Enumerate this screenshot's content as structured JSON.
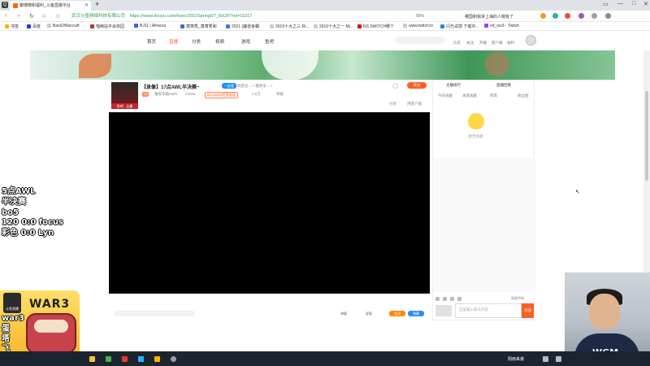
{
  "browser": {
    "tab_title": "秦珊珊和福利_斗鱼直播平台",
    "new_tab_symbol": "+",
    "url_site": "武汉斗鱼网络科技有限公司",
    "url": "https://www.douyu.com/topic/2022SpringST_BXZF?rid=11017",
    "zoom": "90%",
    "hot_news": "哪国和我讲上海的人嗯有了",
    "bookmarks": [
      "书签",
      "百度",
      "Back2Warcraft",
      "喵两站平会依园",
      "BJ11 | Afreeca",
      "萧萧秀_萧萧秀和",
      "2021 (魔兽争霸",
      "2010十大之三 Ri...",
      "2010十大之一 Mi...",
      "NS SWITCH哪个",
      "www.twitch.tv",
      "闪光试感 下载中...",
      "ed_wo3 - Twitch"
    ]
  },
  "douyu_nav": {
    "items": [
      "首页",
      "直播",
      "分类",
      "视频",
      "游戏",
      "鱼吧"
    ],
    "active_index": 1,
    "links": [
      "历史",
      "关注",
      "开播",
      "客户端",
      "福利"
    ]
  },
  "room": {
    "title": "【录像】17点AWL半决赛~",
    "category_tag": "一起看",
    "category_link": "网游竞... > 魔兽争... >",
    "meta_level": "13",
    "meta_name": "魔兽争霸e800",
    "meta_heat": "24008",
    "meta_event": "WCG2019世界总冠",
    "meta_report": "举报",
    "meta_share": "分享",
    "meta_client": "用客户端",
    "meta_follow_count": "1.5万",
    "streamer_badge": "鱼吧 · 云霸",
    "follow_label": "关注"
  },
  "player_bar": {
    "option_1": "弹幕",
    "option_2": "屏蔽",
    "send_1": "发送",
    "send_2": "弹幕"
  },
  "right_panel": {
    "top_left": "主播排行",
    "top_right": "直播回看",
    "tabs": [
      "今日贡献",
      "本周贡献",
      "贵宾",
      "粉丝团"
    ],
    "empty_text": "暂无贡献",
    "chat_placeholder": "这里输入聊天内容",
    "chat_send": "发送",
    "shield_label": "屏蔽特效"
  },
  "overlay": {
    "lines": [
      "5点AWL",
      "半决赛",
      "bo5",
      "120 0:0 focus",
      "彩色 0:0 Lyn"
    ],
    "logo_tv_text": "斗鱼直播",
    "logo_title": "WAR3",
    "streamer_lines": [
      "war3",
      "蛋",
      "塔",
      "飞"
    ],
    "webcam_shirt_logo": "WGM"
  },
  "taskbar": {
    "weather": "阴雨来袭"
  },
  "colors": {
    "accent": "#ff5d23",
    "blue": "#2f8cff",
    "url_green": "#2a9d4a"
  }
}
